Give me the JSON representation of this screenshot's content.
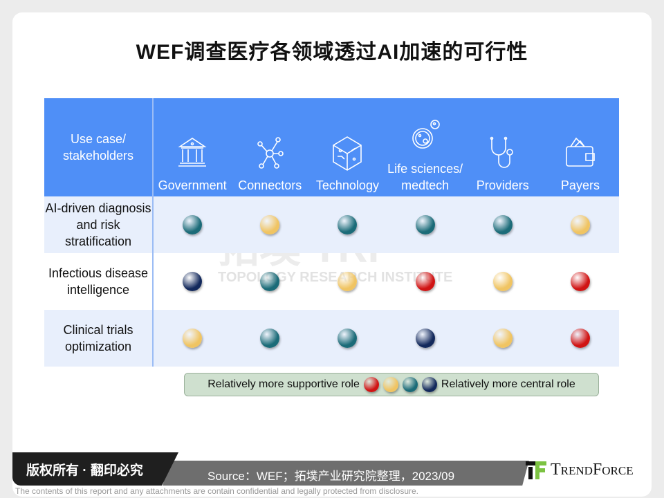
{
  "title": "WEF调查医疗各领域透过AI加速的可行性",
  "colors": {
    "red": "#d01414",
    "yellow": "#f0c462",
    "teal": "#1b6b78",
    "navy": "#13295c",
    "header": "#4f8ff7"
  },
  "header": {
    "corner": "Use case/ stakeholders",
    "columns": [
      {
        "label": "Government",
        "icon": "government-building-icon"
      },
      {
        "label": "Connectors",
        "icon": "network-nodes-icon"
      },
      {
        "label": "Technology",
        "icon": "circuit-cube-icon"
      },
      {
        "label": "Life sciences/ medtech",
        "icon": "cell-microbe-icon"
      },
      {
        "label": "Providers",
        "icon": "stethoscope-icon"
      },
      {
        "label": "Payers",
        "icon": "wallet-icon"
      }
    ]
  },
  "rows": [
    {
      "label": "AI-driven diagnosis and risk stratification",
      "values": [
        "teal",
        "yellow",
        "teal",
        "teal",
        "teal",
        "yellow"
      ]
    },
    {
      "label": "Infectious disease intelligence",
      "values": [
        "navy",
        "teal",
        "yellow",
        "red",
        "yellow",
        "red"
      ]
    },
    {
      "label": "Clinical trials optimization",
      "values": [
        "yellow",
        "teal",
        "teal",
        "navy",
        "yellow",
        "red"
      ]
    }
  ],
  "legend": {
    "left": "Relatively more supportive role",
    "right": "Relatively more central role",
    "scale": [
      "red",
      "yellow",
      "teal",
      "navy"
    ]
  },
  "watermark": {
    "logo": "拓墣 TRI",
    "text": "TOPOLOGY RESEARCH INSTITUTE"
  },
  "footer": {
    "copyright": "版权所有 · 翻印必究",
    "source": "Source：WEF；拓墣产业研究院整理，2023/09",
    "brand": "TrendForce",
    "disclaimer": "The contents of this report and any attachments are contain confidential and legally protected from disclosure."
  }
}
